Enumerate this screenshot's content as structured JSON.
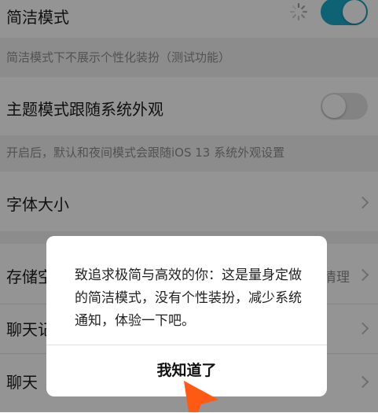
{
  "colors": {
    "accent": "#1aa9c6",
    "toggle_off": "#e2e2e2",
    "pointer": "#ff5a14"
  },
  "settings": [
    {
      "label": "简洁模式",
      "toggle": "on"
    },
    {
      "note": "简洁模式下不展示个性化装扮（测试功能）"
    },
    {
      "label": "主题模式跟随系统外观",
      "toggle": "off"
    },
    {
      "note": "开启后，默认和夜间模式会跟随iOS 13 系统外观设置"
    },
    {
      "label": "字体大小"
    },
    {
      "label": "存储空间",
      "label_visible": "存储空",
      "value": "清理"
    },
    {
      "label_visible": "聊天记",
      "full": "聊天记录"
    },
    {
      "label_visible": "聊天"
    }
  ],
  "dialog": {
    "message": "致追求极简与高效的你：这是量身定做的简洁模式，没有个性装扮，减少系统通知，体验一下吧。",
    "confirm_label": "我知道了"
  },
  "icons": [
    "loading-spinner-icon",
    "chevron-right-icon",
    "pointer-arrow-icon"
  ]
}
